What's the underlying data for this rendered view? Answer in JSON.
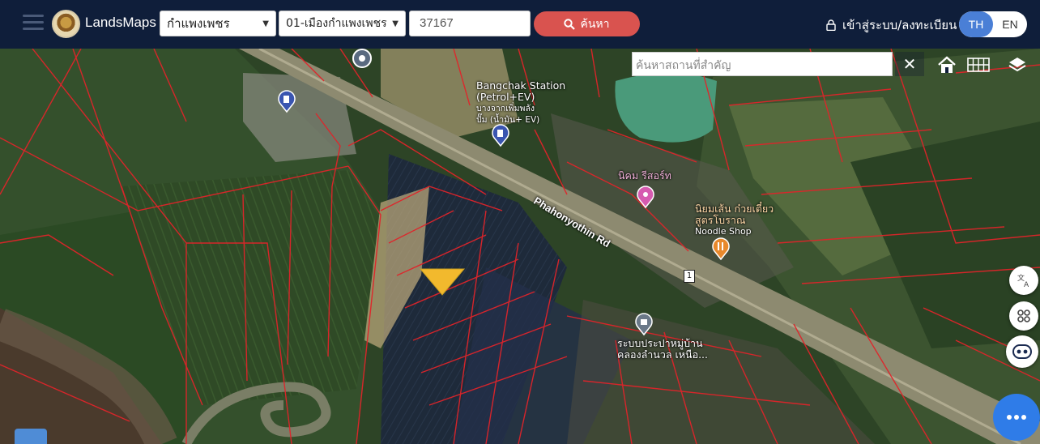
{
  "header": {
    "brand": "LandsMaps",
    "province": "กำแพงเพชร",
    "district": "01-เมืองกำแพงเพชร",
    "parcel_number": "37167",
    "search_label": "ค้นหา",
    "login_label": "เข้าสู่ระบบ/ลงทะเบียน",
    "lang_th": "TH",
    "lang_en": "EN",
    "active_lang": "TH"
  },
  "map": {
    "place_search_placeholder": "ค้นหาสถานที่สำคัญ",
    "road_name": "Phahonyothin Rd",
    "route_number": "1",
    "pois": [
      {
        "name_line1": "Bangchak Station",
        "name_line2": "(Petrol+EV)",
        "name_line3": "บางจากเพิ่มพลัง",
        "name_line4": "ปั๊ม (น้ำมัน+ EV)"
      },
      {
        "name_line1": "นิคม รีสอร์ท"
      },
      {
        "name_line1": "นิยมเส้น ก๋วยเตี๋ยว",
        "name_line2": "สูตรโบราณ",
        "name_line3": "Noodle Shop"
      },
      {
        "name_line1": "ระบบประปาหมู่บ้าน",
        "name_line2": "คลองลำนวล เหนือ..."
      }
    ],
    "colors": {
      "parcel_line": "#e0242a",
      "header_bg": "#0f1e3a",
      "search_button": "#d9534f",
      "lang_active": "#4a7fd6",
      "marker": "#f2b92d",
      "fab": "#2f7ce8"
    }
  },
  "icons": {
    "menu": "hamburger-icon",
    "search": "search-icon",
    "lock": "lock-icon",
    "home": "home-icon",
    "grid": "grid-icon",
    "layers": "layers-icon",
    "translate": "translate-icon",
    "apps": "apps-icon",
    "robot": "robot-icon",
    "more": "more-icon"
  }
}
